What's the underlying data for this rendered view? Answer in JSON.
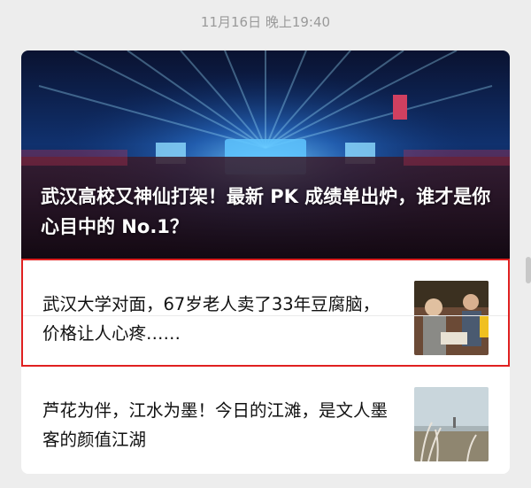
{
  "timestamp": "11月16日 晚上19:40",
  "hero": {
    "title": "武汉高校又神仙打架！最新 PK 成绩单出炉，谁才是你心目中的 No.1？",
    "image": "concert-stage-photo"
  },
  "articles": [
    {
      "title": "武汉大学对面，67岁老人卖了33年豆腐脑，价格让人心疼……",
      "thumbnail": "tofu-vendor-photo",
      "highlighted": true
    },
    {
      "title": "芦花为伴，江水为墨！今日的江滩，是文人墨客的颜值江湖",
      "thumbnail": "riverside-reeds-photo",
      "highlighted": false
    }
  ],
  "colors": {
    "background": "#ededed",
    "card": "#ffffff",
    "highlight": "#e02020",
    "timestamp": "#9a9a9a"
  }
}
